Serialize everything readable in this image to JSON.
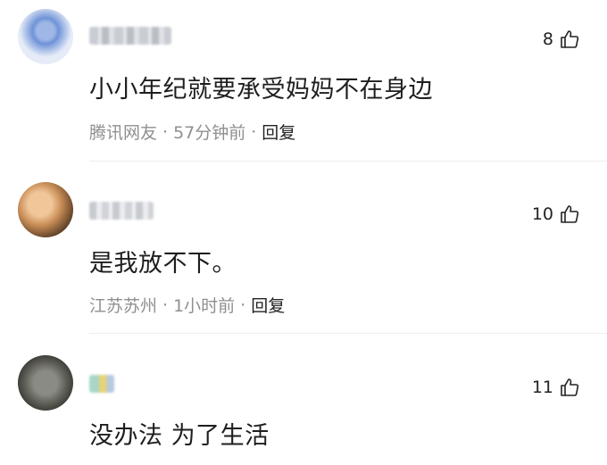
{
  "comments": [
    {
      "likes": "8",
      "text": "小小年纪就要承受妈妈不在身边",
      "location": "腾讯网友",
      "time": "57分钟前",
      "reply": "回复"
    },
    {
      "likes": "10",
      "text": "是我放不下。",
      "location": "江苏苏州",
      "time": "1小时前",
      "reply": "回复"
    },
    {
      "likes": "11",
      "text": "没办法 为了生活"
    }
  ],
  "meta_separator": "·",
  "icons": {
    "like": "thumbs-up-icon"
  }
}
